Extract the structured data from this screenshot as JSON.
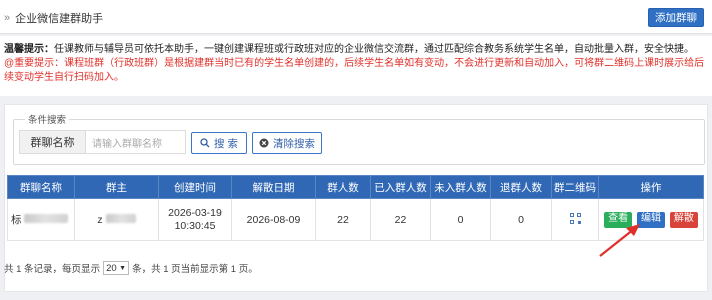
{
  "header": {
    "title": "企业微信建群助手",
    "add_button": "添加群聊"
  },
  "notice": {
    "tip_label": "温馨提示：",
    "tip_text": "任课教师与辅导员可依托本助手，一键创建课程班或行政班对应的企业微信交流群，通过匹配综合教务系统学生名单，自动批量入群，安全快捷。",
    "warn_text": "@重要提示：课程班群（行政班群）是根据建群当时已有的学生名单创建的，后续学生名单如有变动，不会进行更新和自动加入，可将群二维码上课时展示给后续变动学生自行扫码加入。"
  },
  "search": {
    "legend": "条件搜索",
    "field_label": "群聊名称",
    "placeholder": "请输入群聊名称",
    "search_button": "搜 索",
    "clear_button": "清除搜索"
  },
  "table": {
    "columns": [
      "群聊名称",
      "群主",
      "创建时间",
      "解散日期",
      "群人数",
      "已入群人数",
      "未入群人数",
      "退群人数",
      "群二维码",
      "操作"
    ],
    "rows": [
      {
        "name_prefix": "标",
        "owner_prefix": "z",
        "created_date": "2026-03-19",
        "created_time": "10:30:45",
        "dissolve_date": "2026-08-09",
        "member_count": "22",
        "joined_count": "22",
        "not_joined_count": "0",
        "left_count": "0",
        "actions": {
          "view": "查看",
          "edit": "编辑",
          "dissolve": "解散"
        }
      }
    ]
  },
  "footer": {
    "total_text": "共 1 条记录，每页显示",
    "page_size": "20",
    "after_text": "条，共 1 页当前显示第 1 页。"
  },
  "colors": {
    "primary": "#3168b5",
    "view_btn": "#2bae5b",
    "edit_btn": "#2f6fc4",
    "dissolve_btn": "#d9443a",
    "warn_text": "#e0302a"
  }
}
